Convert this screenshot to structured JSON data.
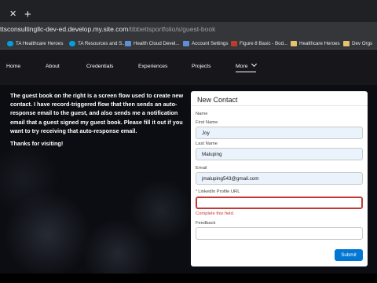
{
  "browser": {
    "url_host": "ttsconsultingllc-dev-ed.develop.my.site.com",
    "url_path": "/tibbettsportfolio/s/guest-book",
    "tab_close_glyph": "✕",
    "new_tab_glyph": "+"
  },
  "bookmarks": [
    {
      "label": "TA Healthcare Heroes",
      "icon": "cloud-icon"
    },
    {
      "label": "TA Resources and S...",
      "icon": "cloud-icon"
    },
    {
      "label": "Health Cloud Devel...",
      "icon": "salesforce-icon"
    },
    {
      "label": "Account Settings",
      "icon": "salesforce-icon"
    },
    {
      "label": "Figure 8 Basic - Bod...",
      "icon": "fx-icon"
    },
    {
      "label": "Healthcare Heroes",
      "icon": "folder-icon"
    },
    {
      "label": "Dev Orgs",
      "icon": "folder-icon"
    }
  ],
  "nav": {
    "home": "Home",
    "about": "About",
    "credentials": "Credentials",
    "experiences": "Experiences",
    "projects": "Projects",
    "more": "More"
  },
  "intro": {
    "text": "The guest book on the right is a screen flow used to create new contact. I have record-triggered flow that then sends an auto-response email to the guest, and also sends me a notification email that a guest signed my guest book. Please fill it out if you want to try receiving that auto-response email.",
    "thanks": "Thanks for visiting!"
  },
  "form": {
    "title": "New Contact",
    "name_label": "Name",
    "first_name_label": "First Name",
    "first_name_value": "Joy",
    "last_name_label": "Last Name",
    "last_name_value": "Maluping",
    "email_label": "Email",
    "email_value": "jmaluping543@gmail.com",
    "linkedin_required_mark": "*",
    "linkedin_label": "LinkedIn Profile URL",
    "linkedin_value": "",
    "linkedin_error": "Complete this field.",
    "feedback_label": "Feedback",
    "feedback_value": "",
    "submit_label": "Submit"
  },
  "colors": {
    "brand_button": "#0176d3",
    "error": "#c23934",
    "filled_field": "#eaf2fb",
    "nav_background": "#16161b"
  }
}
